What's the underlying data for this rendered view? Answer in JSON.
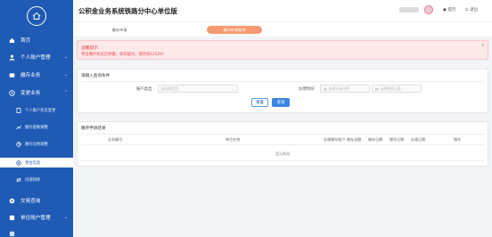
{
  "header": {
    "title": "公积金业务系统铁路分中心单位版",
    "notice_label": "提示",
    "logout_label": "退出"
  },
  "sidebar": {
    "items": [
      {
        "label": "首页",
        "icon": "home-icon"
      },
      {
        "label": "个人账户管理",
        "icon": "person-icon"
      },
      {
        "label": "缴存业务",
        "icon": "deposit-icon"
      },
      {
        "label": "变更业务",
        "icon": "change-icon"
      }
    ],
    "subitems": [
      {
        "label": "个人账户状态变更",
        "icon": "doc-icon"
      },
      {
        "label": "缴存基数调整",
        "icon": "adjust-icon"
      },
      {
        "label": "缴存比例调整",
        "icon": "ratio-icon"
      },
      {
        "label": "单位信息",
        "icon": "unit-icon"
      },
      {
        "label": "内部转移",
        "icon": "transfer-icon"
      }
    ],
    "bottom_items": [
      {
        "label": "交易查询",
        "icon": "query-icon"
      },
      {
        "label": "单位账户管理",
        "icon": "account-icon"
      }
    ]
  },
  "tabs": {
    "tab1": "缴存申请",
    "tab2": "缴存申请查询"
  },
  "alert": {
    "title": "温馨提示",
    "message": "单位缴存状态已停缴，如有疑问，请咨询12329！"
  },
  "query": {
    "title": "请输入查询条件",
    "account_type_label": "账户类型",
    "account_type_placeholder": "请选择类型",
    "handle_time_label": "办理时间",
    "start_placeholder": "选择开始日期",
    "end_placeholder": "选择结束日期",
    "range_sep": "至",
    "reset_label": "重置",
    "search_label": "查询"
  },
  "result": {
    "title": "缴存申请结果",
    "columns": [
      "业务编号",
      "单位名称",
      "办理缴存账户",
      "缴存金额",
      "缴存日期",
      "操作日期",
      "办理日期",
      "操作"
    ],
    "empty_text": "暂无数据"
  },
  "colors": {
    "sidebar_bg": "#1f5bb5",
    "active_tab": "#f59a71",
    "primary": "#3a86e3",
    "alert_text": "#e5484d"
  }
}
